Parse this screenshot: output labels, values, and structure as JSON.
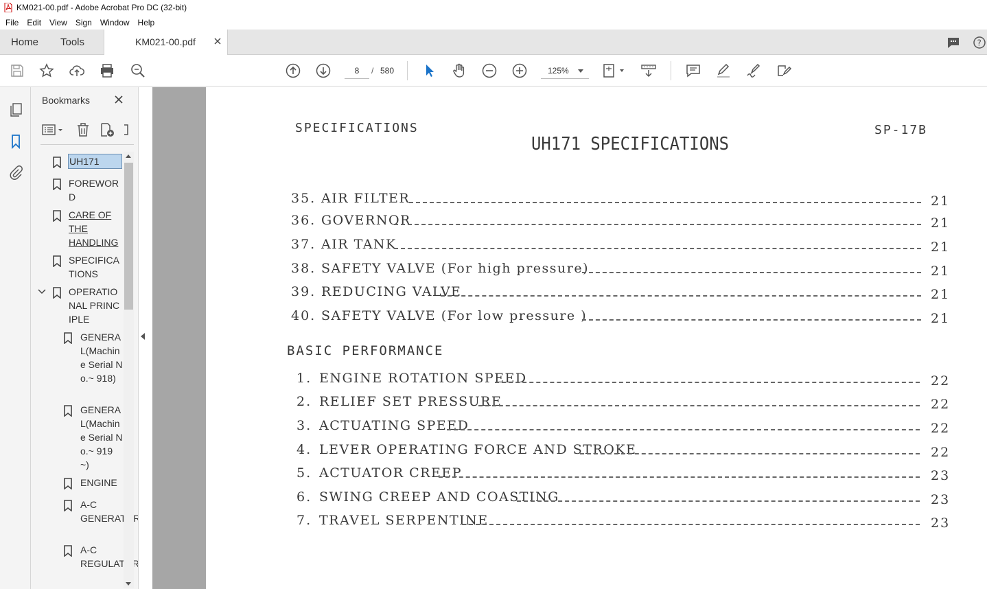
{
  "window": {
    "title": "KM021-00.pdf - Adobe Acrobat Pro DC (32-bit)"
  },
  "menu": [
    "File",
    "Edit",
    "View",
    "Sign",
    "Window",
    "Help"
  ],
  "tabs": {
    "home": "Home",
    "tools": "Tools",
    "document": "KM021-00.pdf"
  },
  "toolbar": {
    "page_current": "8",
    "page_separator": "/",
    "page_total": "580",
    "zoom": "125%"
  },
  "bookmarks": {
    "header": "Bookmarks",
    "items": [
      {
        "label": "UH171",
        "selected": true
      },
      {
        "label": "FOREWORD"
      },
      {
        "label": "CARE OF THE HANDLING",
        "link": true
      },
      {
        "label": "SPECIFICATIONS"
      },
      {
        "label": "OPERATIONAL PRINCIPLE",
        "expanded": true
      },
      {
        "label": "GENERAL(Machine Serial No.~ 918)"
      },
      {
        "label": "GENERAL(Machine Serial No.~ 919 ~)"
      },
      {
        "label": "ENGINE"
      },
      {
        "label": "A-C GENERATOR"
      },
      {
        "label": "A-C REGULATOR"
      }
    ]
  },
  "document": {
    "header_left": "SPECIFICATIONS",
    "header_right": "SP-17B",
    "title": "UH171 SPECIFICATIONS",
    "section_heading": "BASIC PERFORMANCE",
    "list_a": [
      {
        "num": "35.",
        "label": "AIR FILTER",
        "page": "21"
      },
      {
        "num": "36.",
        "label": "GOVERNOR",
        "page": "21"
      },
      {
        "num": "37.",
        "label": "AIR TANK",
        "page": "21"
      },
      {
        "num": "38.",
        "label": "SAFETY VALVE (For high pressure)",
        "page": "21"
      },
      {
        "num": "39.",
        "label": "REDUCING VALVE",
        "page": "21"
      },
      {
        "num": "40.",
        "label": "SAFETY VALVE (For low pressure )",
        "page": "21"
      }
    ],
    "list_b": [
      {
        "num": "1.",
        "label": "ENGINE ROTATION SPEED",
        "page": "22"
      },
      {
        "num": "2.",
        "label": "RELIEF SET PRESSURE",
        "page": "22"
      },
      {
        "num": "3.",
        "label": "ACTUATING SPEED",
        "page": "22"
      },
      {
        "num": "4.",
        "label": "LEVER OPERATING FORCE AND STROKE",
        "page": "22"
      },
      {
        "num": "5.",
        "label": "ACTUATOR CREEP",
        "page": "23"
      },
      {
        "num": "6.",
        "label": "SWING CREEP AND COASTING",
        "page": "23"
      },
      {
        "num": "7.",
        "label": "TRAVEL SERPENTINE",
        "page": "23"
      }
    ]
  }
}
